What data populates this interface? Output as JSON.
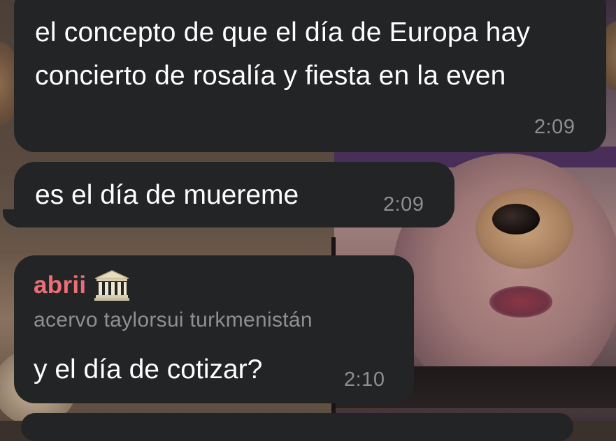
{
  "messages": [
    {
      "text": "el concepto de que el día de Europa hay concierto de rosalía y fiesta en la even",
      "time": "2:09"
    },
    {
      "text": "es el día de muereme",
      "time": "2:09"
    },
    {
      "sender": "abrii",
      "sender_icon": "classical-building-icon",
      "sender_subtitle": "acervo taylorsui turkmenistán",
      "text": "y el día de cotizar?",
      "time": "2:10"
    }
  ],
  "colors": {
    "bubble_bg": "#232425",
    "text": "#ffffff",
    "timestamp": "#8e8f90",
    "sender_name": "#ec6f78"
  }
}
